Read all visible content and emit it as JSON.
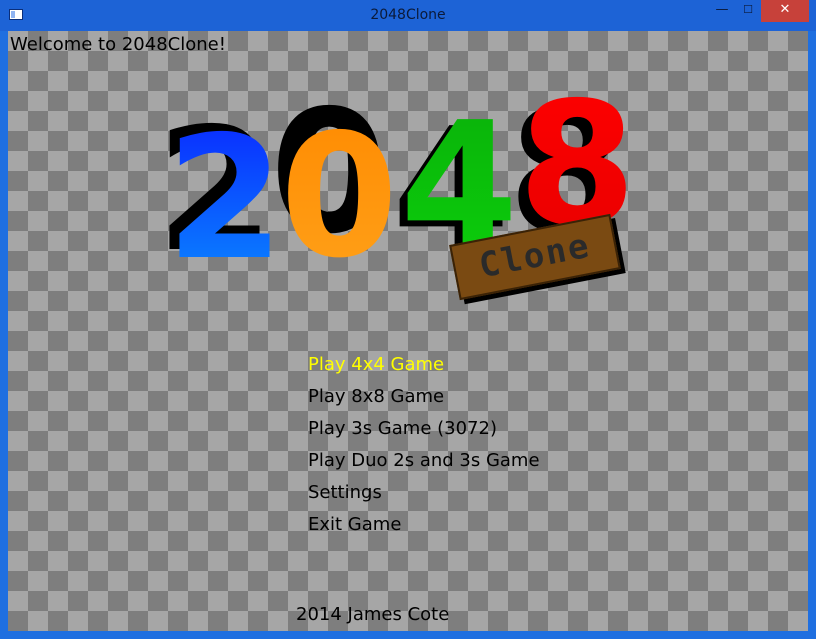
{
  "window": {
    "title": "2048Clone",
    "minimize_glyph": "—",
    "maximize_glyph": "☐",
    "close_glyph": "✕",
    "icon": "app-window-icon"
  },
  "welcome": "Welcome to 2048Clone!",
  "logo": {
    "digits": [
      {
        "char": "2",
        "color": "#0a5cff"
      },
      {
        "char": "0",
        "color": "#ff9a00"
      },
      {
        "char": "4",
        "color": "#0cc00c"
      },
      {
        "char": "8",
        "color": "#ff0000"
      }
    ],
    "subtitle": "Clone",
    "plank_color": "#7a4a12"
  },
  "menu": {
    "items": [
      {
        "label": "Play 4x4 Game",
        "selected": true
      },
      {
        "label": "Play 8x8 Game",
        "selected": false
      },
      {
        "label": "Play 3s Game (3072)",
        "selected": false
      },
      {
        "label": "Play Duo 2s and 3s Game",
        "selected": false
      },
      {
        "label": "Settings",
        "selected": false
      },
      {
        "label": "Exit Game",
        "selected": false
      }
    ],
    "selected_color": "#ffff00"
  },
  "footer": "2014 James Cote"
}
